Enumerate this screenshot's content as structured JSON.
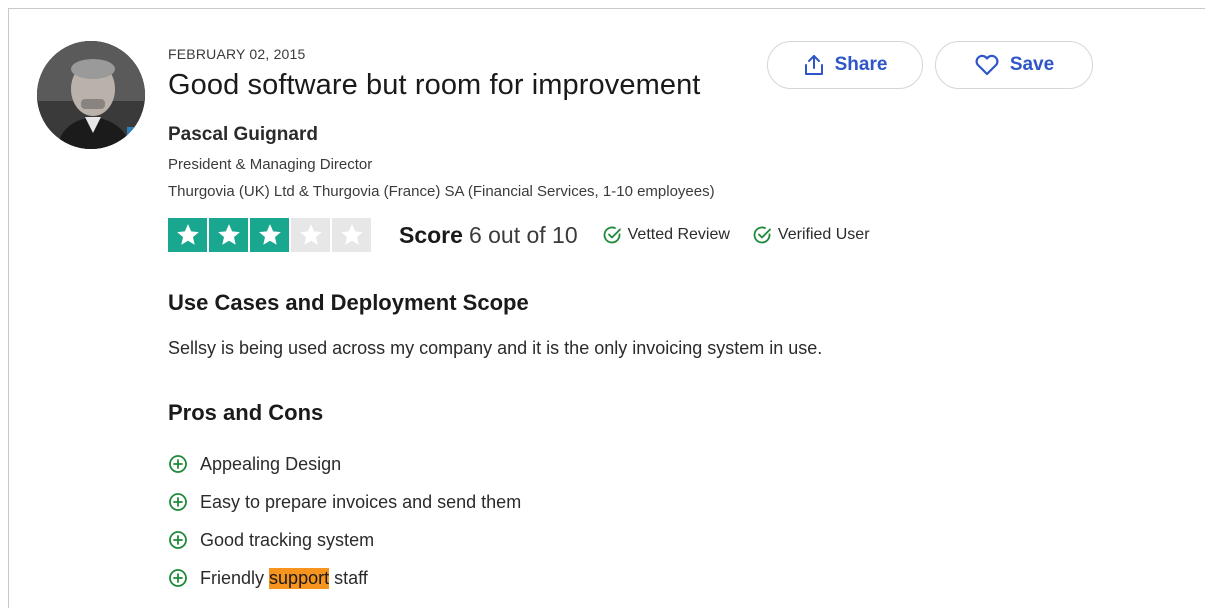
{
  "review": {
    "date": "FEBRUARY 02, 2015",
    "title": "Good software but room for improvement",
    "reviewer": {
      "name": "Pascal Guignard",
      "role": "President & Managing Director",
      "company": "Thurgovia (UK) Ltd & Thurgovia (France) SA (Financial Services, 1-10 employees)"
    },
    "actions": {
      "share_label": "Share",
      "save_label": "Save"
    },
    "rating": {
      "stars_filled": 3,
      "stars_total": 5,
      "score_label": "Score",
      "score_value": "6 out of 10",
      "badges": {
        "vetted": "Vetted Review",
        "verified": "Verified User"
      }
    },
    "sections": {
      "use_cases": {
        "heading": "Use Cases and Deployment Scope",
        "text": "Sellsy is being used across my company and it is the only invoicing system in use."
      },
      "pros_cons": {
        "heading": "Pros and Cons",
        "pros": [
          "Appealing Design",
          "Easy to prepare invoices and send them",
          "Good tracking system"
        ],
        "last_pro": {
          "before": "Friendly",
          "highlight": "support",
          "after": "staff"
        }
      }
    }
  },
  "colors": {
    "star_filled": "#19a88f",
    "star_empty": "#e7e7e7",
    "action_blue": "#2e56c8",
    "check_green": "#1f8a3b",
    "highlight": "#f7941d"
  },
  "icons": {
    "share": "share-icon",
    "save": "heart-icon",
    "badge": "check-circle-icon",
    "pro": "plus-circle-icon",
    "star": "star-icon"
  }
}
